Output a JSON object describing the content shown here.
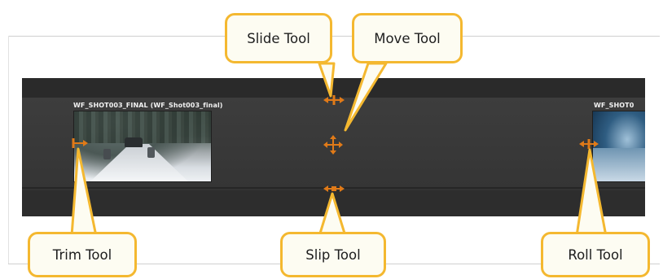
{
  "timeline": {
    "clip1_label": "WF_SHOT003_FINAL (WF_Shot003_final)",
    "clip2_label": "WF_SHOT0"
  },
  "callouts": {
    "slide": "Slide Tool",
    "move": "Move Tool",
    "trim": "Trim Tool",
    "slip": "Slip Tool",
    "roll": "Roll Tool"
  },
  "colors": {
    "callout_border": "#f4b830",
    "callout_fill": "#fdfcf2",
    "handle": "#e07a18",
    "timeline_bg": "#333333"
  },
  "icons": {
    "trim": "trim-handle-icon",
    "slide": "slide-handle-icon",
    "move": "move-handle-icon",
    "slip": "slip-handle-icon",
    "roll": "roll-handle-icon"
  }
}
